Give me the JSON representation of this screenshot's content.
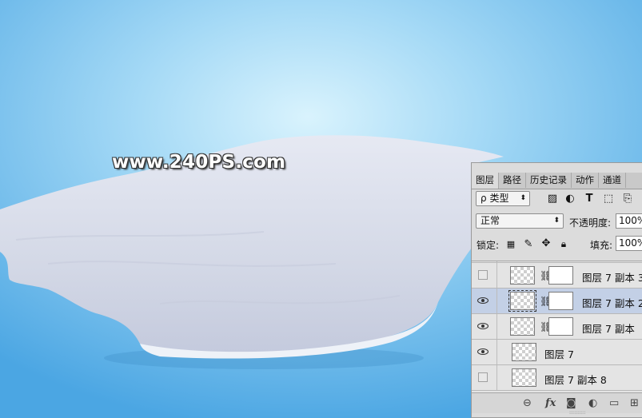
{
  "watermark": "www.240PS.com",
  "panel": {
    "tabs": [
      {
        "label": "图层"
      },
      {
        "label": "路径"
      },
      {
        "label": "历史记录"
      },
      {
        "label": "动作"
      },
      {
        "label": "通道"
      }
    ],
    "filter": {
      "kind_label": "类型",
      "kind_prefix": "ρ"
    },
    "blend_mode": "正常",
    "opacity_label": "不透明度:",
    "opacity_value": "100%",
    "lock_label": "锁定:",
    "fill_label": "填充:",
    "fill_value": "100%",
    "layers": [
      {
        "name": "图层 7 副本 3",
        "visible": false,
        "has_mask": true,
        "selected": false
      },
      {
        "name": "图层 7 副本 2",
        "visible": true,
        "has_mask": true,
        "selected": true
      },
      {
        "name": "图层 7 副本",
        "visible": true,
        "has_mask": true,
        "selected": false
      },
      {
        "name": "图层 7",
        "visible": true,
        "has_mask": false,
        "selected": false
      },
      {
        "name": "图层 7 副本 8",
        "visible": false,
        "has_mask": false,
        "selected": false
      }
    ],
    "bottom_icons": [
      "link-icon",
      "fx-icon",
      "mask-icon",
      "adjustment-icon",
      "folder-icon",
      "new-layer-icon"
    ],
    "fx_label": "fx"
  },
  "colors": {
    "sky_top": "#8fcdf2",
    "sky_bottom": "#4aa5e2",
    "snow": "#dfe3ee",
    "selected_layer": "#c3d0e6"
  }
}
